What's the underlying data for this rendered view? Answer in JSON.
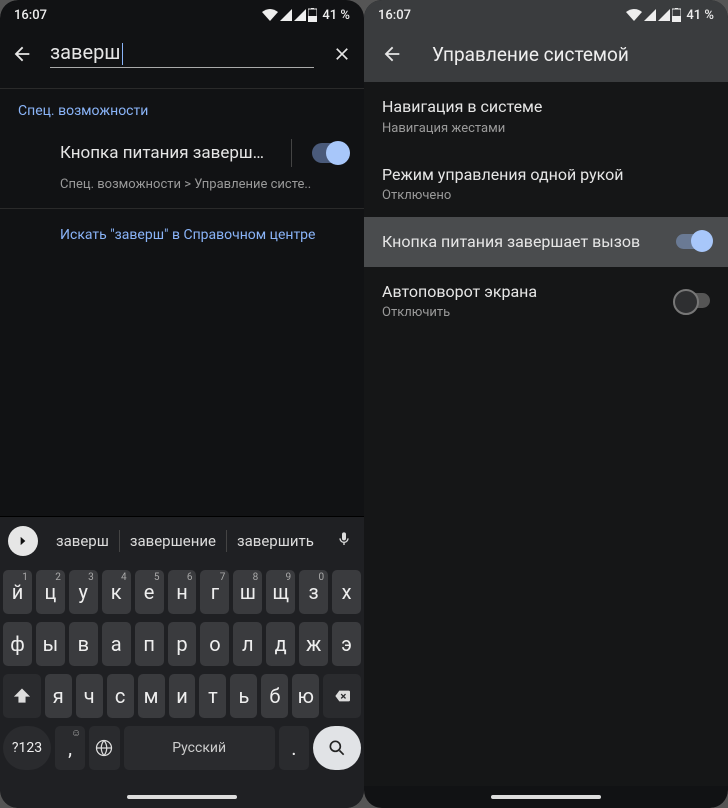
{
  "status": {
    "time": "16:07",
    "battery": "41 %"
  },
  "left": {
    "search_value": "заверш",
    "section_label": "Спец. возможности",
    "result_title": "Кнопка питания заверш…",
    "result_path": "Спец. возможности > Управление систе..",
    "help_link": "Искать \"заверш\" в Справочном центре",
    "suggestions": [
      "заверш",
      "завершение",
      "завершить"
    ],
    "kb_row1": [
      {
        "k": "й",
        "n": "1"
      },
      {
        "k": "ц",
        "n": "2"
      },
      {
        "k": "у",
        "n": "3"
      },
      {
        "k": "к",
        "n": "4"
      },
      {
        "k": "е",
        "n": "5"
      },
      {
        "k": "н",
        "n": "6"
      },
      {
        "k": "г",
        "n": "7"
      },
      {
        "k": "ш",
        "n": "8"
      },
      {
        "k": "щ",
        "n": "9"
      },
      {
        "k": "з",
        "n": "0"
      },
      {
        "k": "х",
        "n": ""
      }
    ],
    "kb_row2": [
      "ф",
      "ы",
      "в",
      "а",
      "п",
      "р",
      "о",
      "л",
      "д",
      "ж",
      "э"
    ],
    "kb_row3": [
      "я",
      "ч",
      "с",
      "м",
      "и",
      "т",
      "ь",
      "б",
      "ю"
    ],
    "sym_label": "?123",
    "space_label": "Русский",
    "period": "."
  },
  "right": {
    "title": "Управление системой",
    "items": [
      {
        "title": "Навигация в системе",
        "sub": "Навигация жестами",
        "toggle": null
      },
      {
        "title": "Режим управления одной рукой",
        "sub": "Отключено",
        "toggle": null
      },
      {
        "title": "Кнопка питания завершает вызов",
        "sub": "",
        "toggle": "on",
        "highlight": true
      },
      {
        "title": "Автоповорот экрана",
        "sub": "Отключить",
        "toggle": "off"
      }
    ]
  }
}
